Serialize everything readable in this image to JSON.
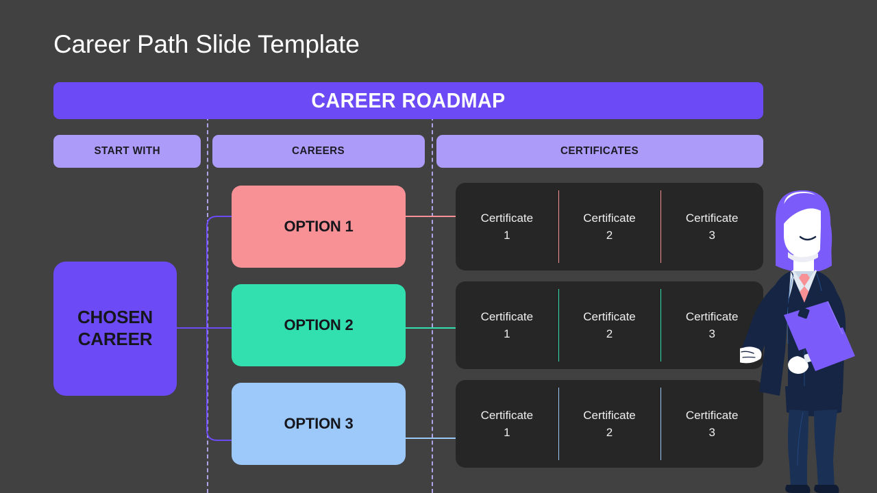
{
  "slide": {
    "title": "Career Path Slide Template",
    "background_color": "#414141"
  },
  "banner": {
    "label": "CAREER ROADMAP",
    "background_color": "#6C4BF7",
    "text_color": "#FFFFFF"
  },
  "column_headers": [
    {
      "label": "START WITH",
      "color": "#AC9BF8"
    },
    {
      "label": "CAREERS",
      "color": "#AC9BF8"
    },
    {
      "label": "CERTIFICATES",
      "color": "#AC9BF8"
    }
  ],
  "chosen_career": {
    "line1": "CHOSEN",
    "line2": "CAREER",
    "color": "#6C4BF7"
  },
  "options": [
    {
      "label": "OPTION 1",
      "color": "#F79196"
    },
    {
      "label": "OPTION 2",
      "color": "#31E0AE"
    },
    {
      "label": "OPTION 3",
      "color": "#9CC9FA"
    }
  ],
  "certificate_rows": [
    {
      "accent_color": "#F79196",
      "cells": [
        {
          "name": "Certificate",
          "number": "1"
        },
        {
          "name": "Certificate",
          "number": "2"
        },
        {
          "name": "Certificate",
          "number": "3"
        }
      ]
    },
    {
      "accent_color": "#31E0AE",
      "cells": [
        {
          "name": "Certificate",
          "number": "1"
        },
        {
          "name": "Certificate",
          "number": "2"
        },
        {
          "name": "Certificate",
          "number": "3"
        }
      ]
    },
    {
      "accent_color": "#9CC9FA",
      "cells": [
        {
          "name": "Certificate",
          "number": "1"
        },
        {
          "name": "Certificate",
          "number": "2"
        },
        {
          "name": "Certificate",
          "number": "3"
        }
      ]
    }
  ],
  "guides": {
    "color": "#B0A3E8",
    "style": "dashed"
  },
  "connectors": {
    "trunk_color": "#6C4BF7",
    "row_colors": [
      "#F79196",
      "#31E0AE",
      "#9CC9FA"
    ]
  },
  "illustration": {
    "name": "businesswoman-presenter",
    "hair_color": "#7B5CFA",
    "suit_color": "#152543",
    "tie_color": "#F79196",
    "folder_color": "#7B5CFA",
    "skin_color": "#FFFFFF"
  }
}
